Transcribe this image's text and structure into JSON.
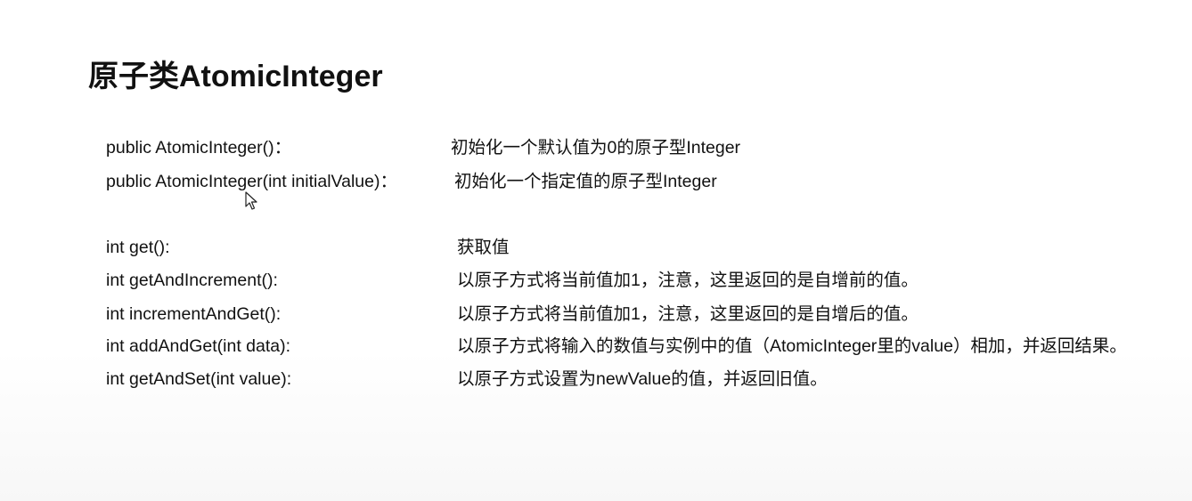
{
  "slide": {
    "title": "原子类AtomicInteger",
    "constructors": [
      {
        "signature": "public AtomicInteger()：",
        "description": "初始化一个默认值为0的原子型Integer"
      },
      {
        "signature": "public AtomicInteger(int initialValue)：",
        "description": "初始化一个指定值的原子型Integer"
      }
    ],
    "methods": [
      {
        "signature": "int get():",
        "description": "获取值"
      },
      {
        "signature": "int getAndIncrement():",
        "description": "以原子方式将当前值加1，注意，这里返回的是自增前的值。"
      },
      {
        "signature": "int incrementAndGet():",
        "description": "以原子方式将当前值加1，注意，这里返回的是自增后的值。"
      },
      {
        "signature": "int addAndGet(int data):",
        "description": "以原子方式将输入的数值与实例中的值（AtomicInteger里的value）相加，并返回结果。"
      },
      {
        "signature": "int getAndSet(int value):",
        "description": "以原子方式设置为newValue的值，并返回旧值。"
      }
    ]
  }
}
